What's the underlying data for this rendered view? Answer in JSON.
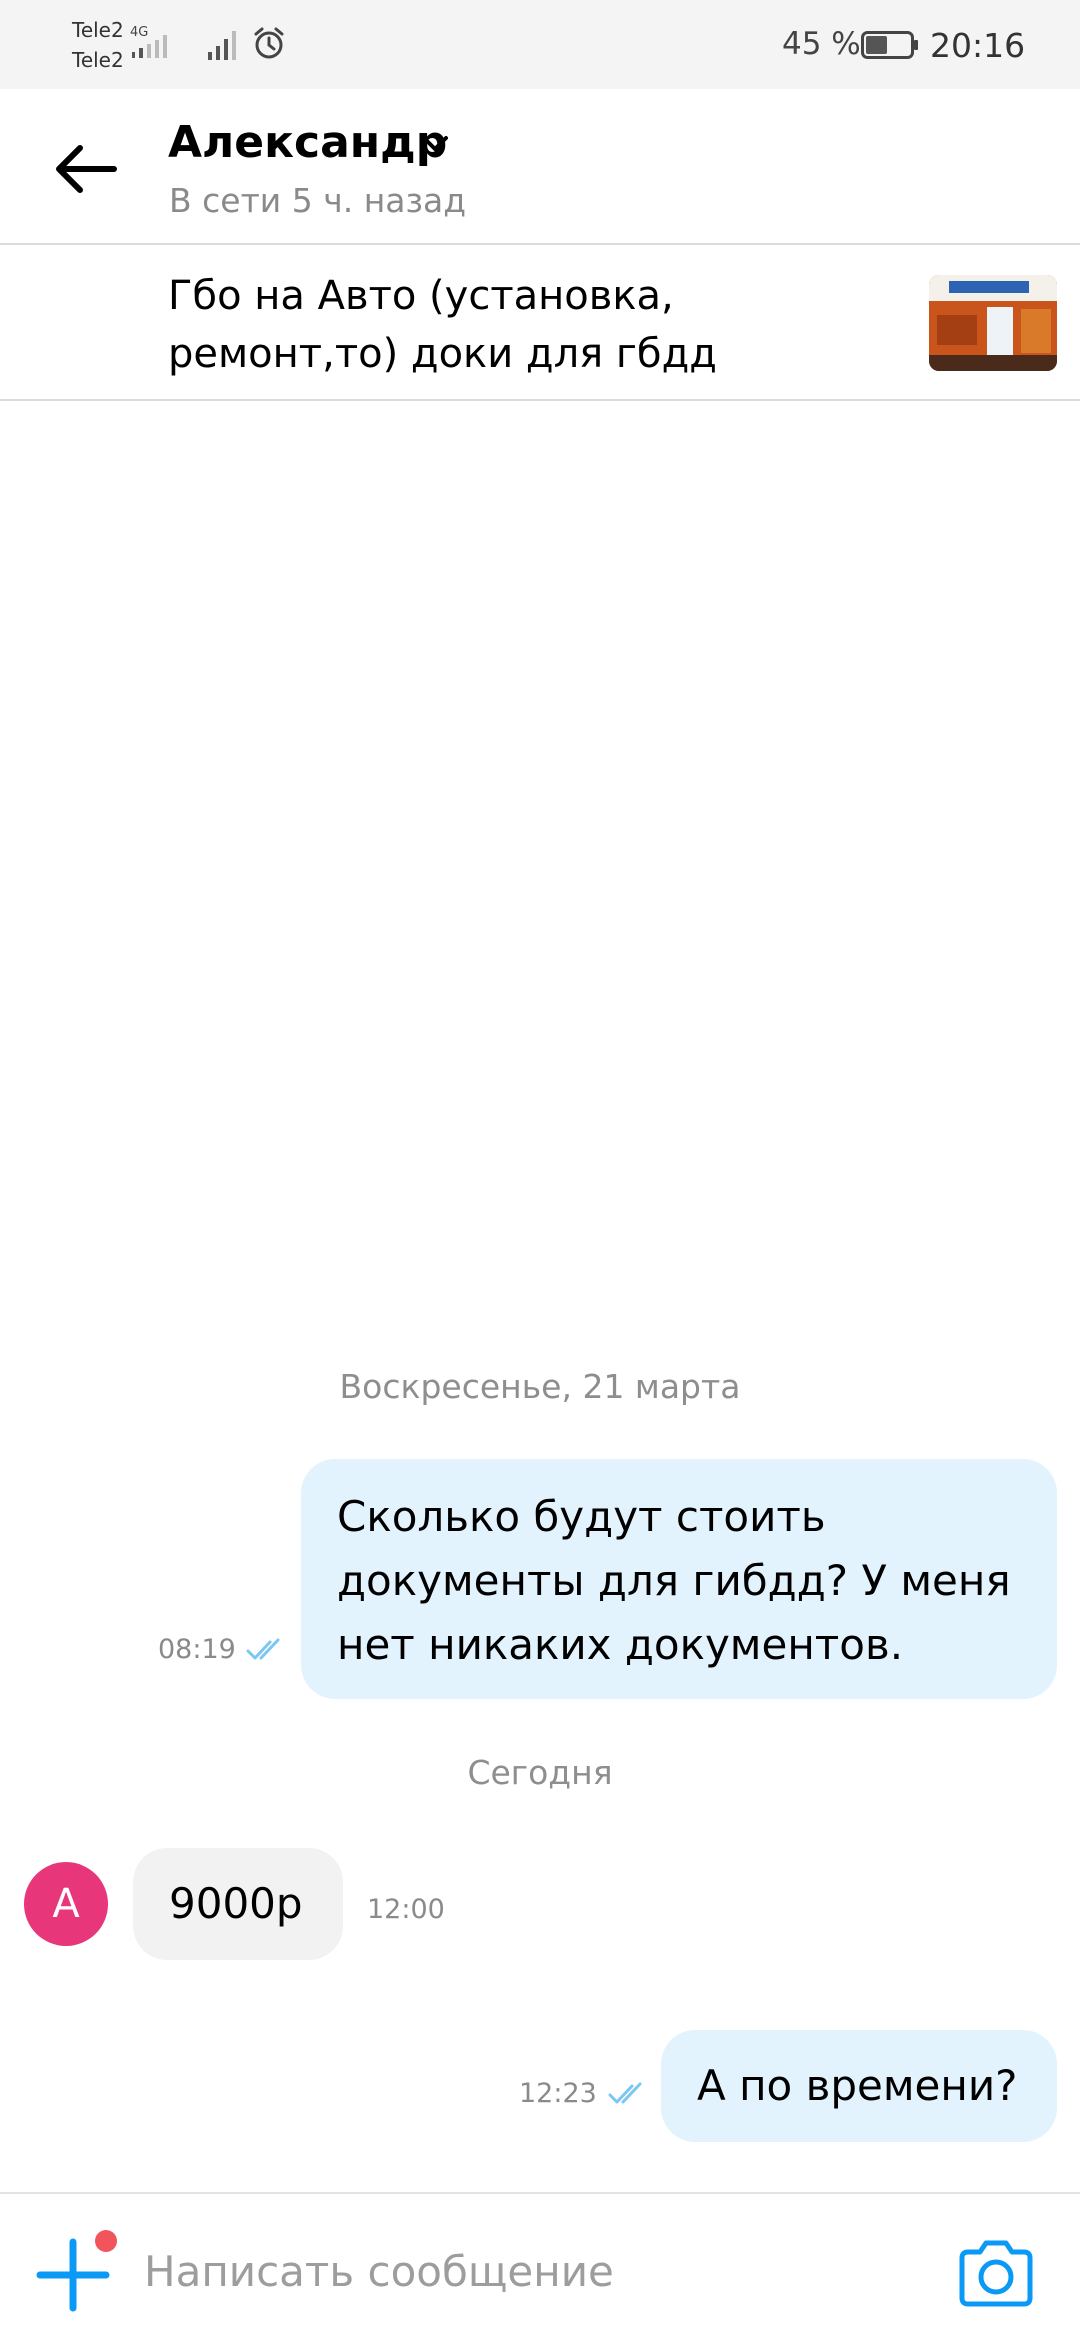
{
  "status_bar": {
    "carrier1": "Tele2",
    "carrier2": "Tele2",
    "network": "4G",
    "battery": "45 %",
    "time": "20:16"
  },
  "header": {
    "contact_name": "Александр",
    "contact_status": "В сети 5 ч. назад"
  },
  "listing": {
    "title": "Гбо на Авто (установка, ремонт,то) доки для гбдд"
  },
  "chat": {
    "date_1": "Воскресенье, 21 марта",
    "msg_1_text": "Сколько будут  стоить документы для гибдд? У меня нет никаких документов.",
    "msg_1_time": "08:19",
    "date_2": "Сегодня",
    "avatar_letter": "А",
    "msg_2_text": "9000р",
    "msg_2_time": "12:00",
    "msg_3_text": "А по времени?",
    "msg_3_time": "12:23"
  },
  "composer": {
    "placeholder": "Написать сообщение"
  },
  "colors": {
    "accent": "#0a9af5",
    "outgoing_bubble": "#e3f3fd",
    "incoming_bubble": "#f2f2f2",
    "avatar": "#e8367a",
    "notification_dot": "#f2545b",
    "read_ticks": "#7cc7f2"
  },
  "icons": [
    "back-arrow-icon",
    "chevron-down-icon",
    "double-check-icon",
    "plus-icon",
    "camera-icon",
    "signal-icon",
    "alarm-icon",
    "battery-icon"
  ]
}
